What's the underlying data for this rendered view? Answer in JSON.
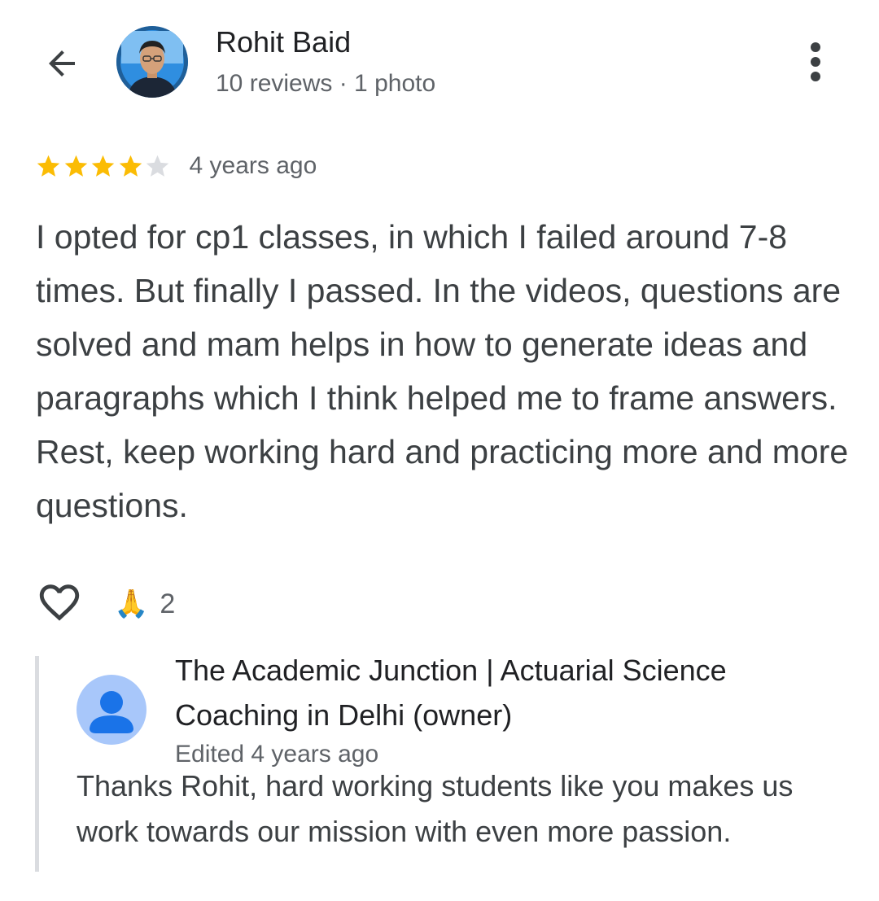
{
  "header": {
    "back_icon": "arrow-left-icon",
    "reviewer_name": "Rohit Baid",
    "reviewer_meta": "10 reviews · 1 photo",
    "more_icon": "more-vertical-icon"
  },
  "review": {
    "rating": 4,
    "max_rating": 5,
    "time": "4 years ago",
    "text": "I opted for cp1 classes, in which I failed around 7-8 times. But finally I passed. In the videos, questions are solved and mam helps in how to generate ideas and paragraphs which I think helped me to frame answers. Rest, keep working hard and practicing more and more questions.",
    "star_filled_color": "#fbbc04",
    "star_empty_color": "#dadce0"
  },
  "actions": {
    "like_icon": "heart-outline-icon",
    "reaction_emoji": "🙏",
    "reaction_count": "2"
  },
  "owner_reply": {
    "avatar_icon": "person-avatar-icon",
    "name": "The Academic Junction | Actuarial Science Coaching in Delhi (owner)",
    "edited": "Edited 4 years ago",
    "text": "Thanks Rohit, hard working students like you makes us work towards our mission with even more passion.",
    "avatar_bg": "#a8c7fa",
    "avatar_fg": "#1a73e8"
  }
}
